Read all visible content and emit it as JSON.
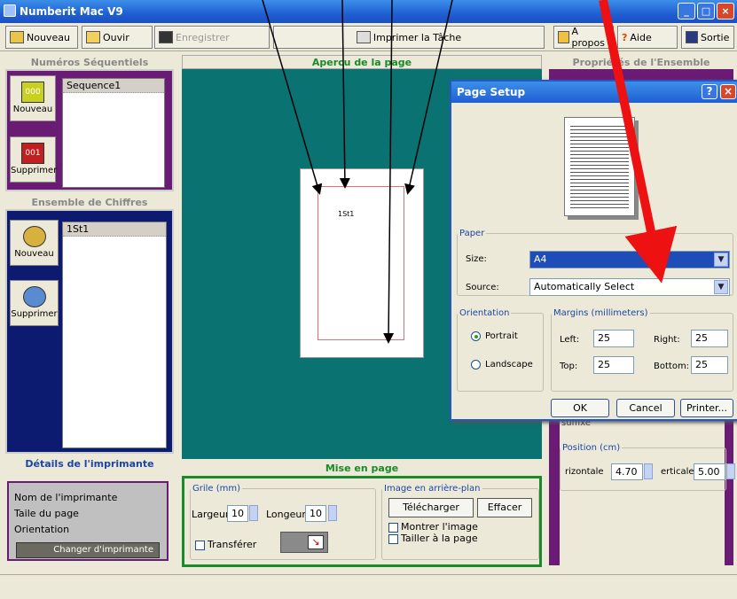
{
  "window": {
    "title": "Numberit Mac V9"
  },
  "toolbar": {
    "nouveau": "Nouveau",
    "ouvir": "Ouvir",
    "enregistrer": "Enregistrer",
    "imprimer": "Imprimer la Tâche",
    "apropos": "A propos",
    "aide": "Aide",
    "sortie": "Sortie"
  },
  "sequentiels": {
    "title": "Numéros Séquentiels",
    "items": [
      "Sequence1"
    ],
    "nouveau": "Nouveau",
    "supprimer": "Supprimer",
    "icon_new_text": "000",
    "icon_del_text": "001"
  },
  "chiffres": {
    "title": "Ensemble de Chiffres",
    "items": [
      "1St1"
    ],
    "nouveau": "Nouveau",
    "supprimer": "Supprimer"
  },
  "preview": {
    "title": "Apercu de la page",
    "page_label": "1St1"
  },
  "ensemble": {
    "title": "Propriétés de l'Ensemble",
    "suffix_label": "suffixe",
    "position_legend": "Position (cm)",
    "horiz_label": "rizontale",
    "horiz_value": "4.70",
    "vert_label": "erticale",
    "vert_value": "5.00"
  },
  "details": {
    "title": "Détails de l'imprimante",
    "nom": "Nom de l'imprimante",
    "taille": "Taile du page",
    "orientation": "Orientation",
    "changer": "Changer d'imprimante"
  },
  "mise": {
    "title": "Mise en page",
    "grille_legend": "Grile  (mm)",
    "largeur_label": "Largeur",
    "largeur_value": "10",
    "longueur_label": "Longeur",
    "longueur_value": "10",
    "transferer": "Transférer",
    "image_legend": "Image en arrière-plan",
    "telecharger": "Télécharger",
    "effacer": "Effacer",
    "montrer": "Montrer l'image",
    "tailler": "Tailler à la page"
  },
  "dialog": {
    "title": "Page Setup",
    "paper_legend": "Paper",
    "size_label": "Size:",
    "size_value": "A4",
    "source_label": "Source:",
    "source_value": "Automatically Select",
    "orientation_legend": "Orientation",
    "portrait": "Portrait",
    "landscape": "Landscape",
    "margins_legend": "Margins (millimeters)",
    "left_label": "Left:",
    "left_value": "25",
    "right_label": "Right:",
    "right_value": "25",
    "top_label": "Top:",
    "top_value": "25",
    "bottom_label": "Bottom:",
    "bottom_value": "25",
    "ok": "OK",
    "cancel": "Cancel",
    "printer": "Printer..."
  },
  "colors": {
    "purple": "#6a1b73",
    "navy": "#0c1b70",
    "teal": "#0b7272",
    "green": "#1a8a2a",
    "arrow_red": "#ee1111"
  }
}
